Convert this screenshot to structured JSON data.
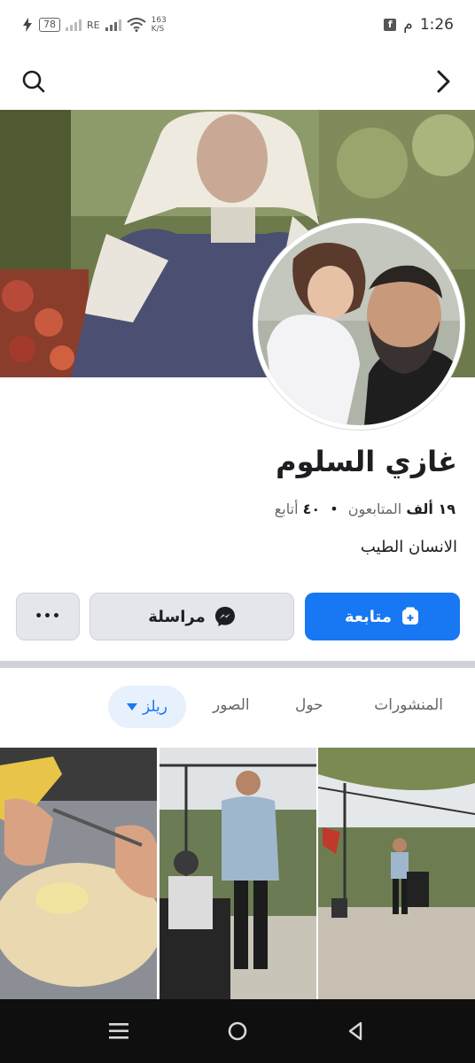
{
  "status_bar": {
    "battery": "78",
    "network": "RE",
    "speed": "163",
    "speed_unit": "K/S",
    "time": "1:26",
    "ampm": "م"
  },
  "profile": {
    "name": "غازي السلوم",
    "followers_count": "١٩ ألف",
    "followers_label": "المتابعون",
    "separator": "•",
    "following_count": "٤٠",
    "following_label": "أتابع",
    "bio": "الانسان الطيب"
  },
  "actions": {
    "follow_label": "متابعة",
    "message_label": "مراسلة",
    "more_label": "•••"
  },
  "tabs": {
    "posts": "المنشورات",
    "about": "حول",
    "photos": "الصور",
    "reels": "ريلز"
  },
  "colors": {
    "accent": "#1877f2",
    "active_tab_bg": "#e7f0fd",
    "button_gray": "#e4e6eb"
  }
}
